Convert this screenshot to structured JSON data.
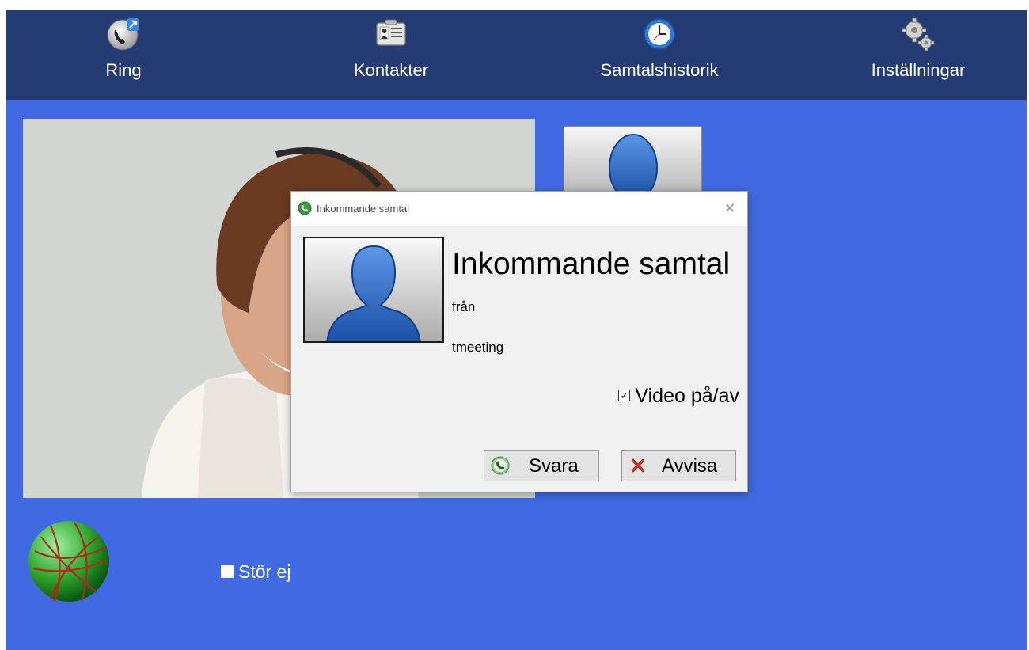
{
  "nav": {
    "items": [
      {
        "label": "Ring",
        "icon": "phone-call-icon"
      },
      {
        "label": "Kontakter",
        "icon": "contact-card-icon"
      },
      {
        "label": "Samtalshistorik",
        "icon": "clock-icon"
      },
      {
        "label": "Inställningar",
        "icon": "gears-icon"
      }
    ]
  },
  "dialog": {
    "window_title": "Inkommande samtal",
    "heading": "Inkommande samtal",
    "from_label": "från",
    "caller_name": "tmeeting",
    "video_toggle": {
      "label": "Video på/av",
      "checked": true
    },
    "answer_label": "Svara",
    "decline_label": "Avvisa",
    "close_glyph": "×"
  },
  "footer": {
    "do_not_disturb": {
      "label": "Stör ej",
      "checked": false
    },
    "status_icon": "globe-icon"
  },
  "colors": {
    "background": "#4169e1",
    "topbar": "#243b74",
    "dialog_bg": "#f0f0f0",
    "avatar_blue": "#2b63b8"
  }
}
